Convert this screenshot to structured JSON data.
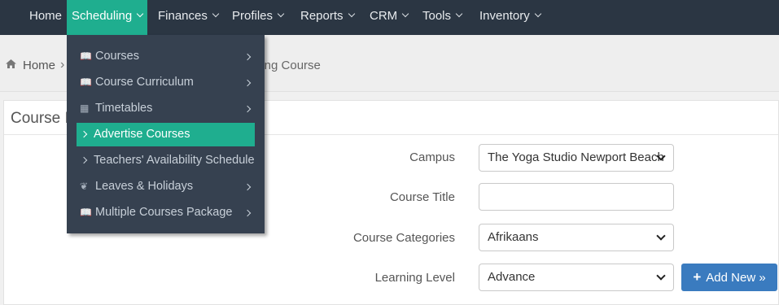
{
  "topnav": {
    "items": [
      {
        "label": "Home",
        "has_chevron": false
      },
      {
        "label": "Scheduling",
        "has_chevron": true,
        "active": true
      },
      {
        "label": "Finances",
        "has_chevron": true
      },
      {
        "label": "Profiles",
        "has_chevron": true
      },
      {
        "label": "Reports",
        "has_chevron": true
      },
      {
        "label": "CRM",
        "has_chevron": true
      },
      {
        "label": "Tools",
        "has_chevron": true
      },
      {
        "label": "Inventory",
        "has_chevron": true
      }
    ]
  },
  "breadcrumb": {
    "home": "Home",
    "separator": "›",
    "current": "ning Course"
  },
  "panel": {
    "title": "Course I"
  },
  "form": {
    "campus_label": "Campus",
    "campus_value": "The Yoga Studio Newport Beach",
    "course_title_label": "Course Title",
    "course_title_value": "",
    "course_categories_label": "Course Categories",
    "course_categories_value": "Afrikaans",
    "learning_level_label": "Learning Level",
    "learning_level_value": "Advance",
    "add_new_label": "Add New »"
  },
  "scheduling_menu": {
    "items": [
      {
        "label": "Courses",
        "icon": "book-icon",
        "submenu": true
      },
      {
        "label": "Course Curriculum",
        "icon": "book-icon",
        "submenu": true
      },
      {
        "label": "Timetables",
        "icon": "calendar-icon",
        "submenu": true
      },
      {
        "label": "Advertise Courses",
        "icon": "chevron-right-icon",
        "submenu": false,
        "active": true
      },
      {
        "label": "Teachers' Availability Schedule",
        "icon": "chevron-right-icon",
        "submenu": false
      },
      {
        "label": "Leaves & Holidays",
        "icon": "leaf-icon",
        "submenu": true
      },
      {
        "label": "Multiple Courses Package",
        "icon": "book-icon",
        "submenu": true
      }
    ]
  },
  "colors": {
    "nav_bg": "#2b3643",
    "menu_bg": "#364150",
    "accent": "#1fae8f",
    "button": "#3a7bbf"
  }
}
